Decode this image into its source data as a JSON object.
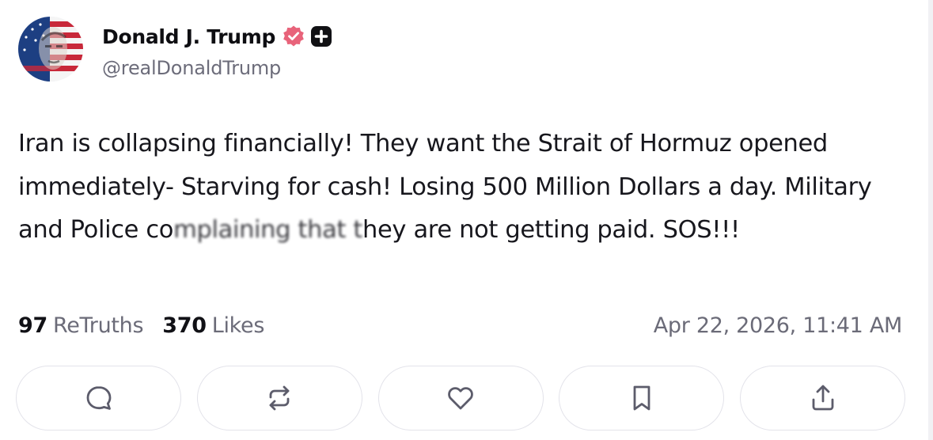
{
  "author": {
    "display_name": "Donald J. Trump",
    "handle": "@realDonaldTrump",
    "verified_icon": "verified-check-icon",
    "plus_icon": "plus-badge-icon",
    "avatar_icon": "avatar"
  },
  "post": {
    "text_before": "Iran is collapsing financially! They want the Strait of Hormuz opened immediately- Starving for cash! Losing 500 Million Dollars a day. Military and Police co",
    "text_blurred": "mplaining that t",
    "text_after": "hey are not getting paid. SOS!!!"
  },
  "stats": {
    "retruths_count": "97",
    "retruths_label": "ReTruths",
    "likes_count": "370",
    "likes_label": "Likes",
    "timestamp": "Apr 22, 2026, 11:41 AM"
  },
  "actions": [
    {
      "name": "reply",
      "icon": "comment-icon"
    },
    {
      "name": "retruth",
      "icon": "repost-icon"
    },
    {
      "name": "like",
      "icon": "heart-icon"
    },
    {
      "name": "bookmark",
      "icon": "bookmark-icon"
    },
    {
      "name": "share",
      "icon": "share-icon"
    }
  ],
  "colors": {
    "verified_badge": "#e8637a",
    "text_primary": "#0f0f14",
    "text_secondary": "#6b6b78",
    "icon_stroke": "#5c5c6b",
    "button_border": "#e3e3ea"
  }
}
